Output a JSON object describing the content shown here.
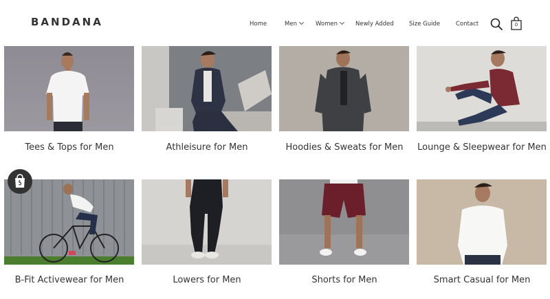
{
  "brand": {
    "logo_text": "BANDANA"
  },
  "nav": {
    "items": [
      {
        "label": "Home",
        "has_dropdown": false
      },
      {
        "label": "Men",
        "has_dropdown": true
      },
      {
        "label": "Women",
        "has_dropdown": true
      },
      {
        "label": "Newly Added",
        "has_dropdown": false
      },
      {
        "label": "Size Guide",
        "has_dropdown": false
      },
      {
        "label": "Contact",
        "has_dropdown": false
      }
    ]
  },
  "cart": {
    "count": "0"
  },
  "icons": {
    "search": "search-icon",
    "cart": "shopping-bag-icon",
    "shop": "shopify-bag-icon"
  },
  "categories": [
    {
      "label": "Tees & Tops for Men"
    },
    {
      "label": "Athleisure for Men"
    },
    {
      "label": "Hoodies & Sweats for Men"
    },
    {
      "label": "Lounge & Sleepwear for Men"
    },
    {
      "label": "B-Fit Activewear for Men"
    },
    {
      "label": "Lowers for Men"
    },
    {
      "label": "Shorts for Men"
    },
    {
      "label": "Smart Casual for Men"
    }
  ]
}
